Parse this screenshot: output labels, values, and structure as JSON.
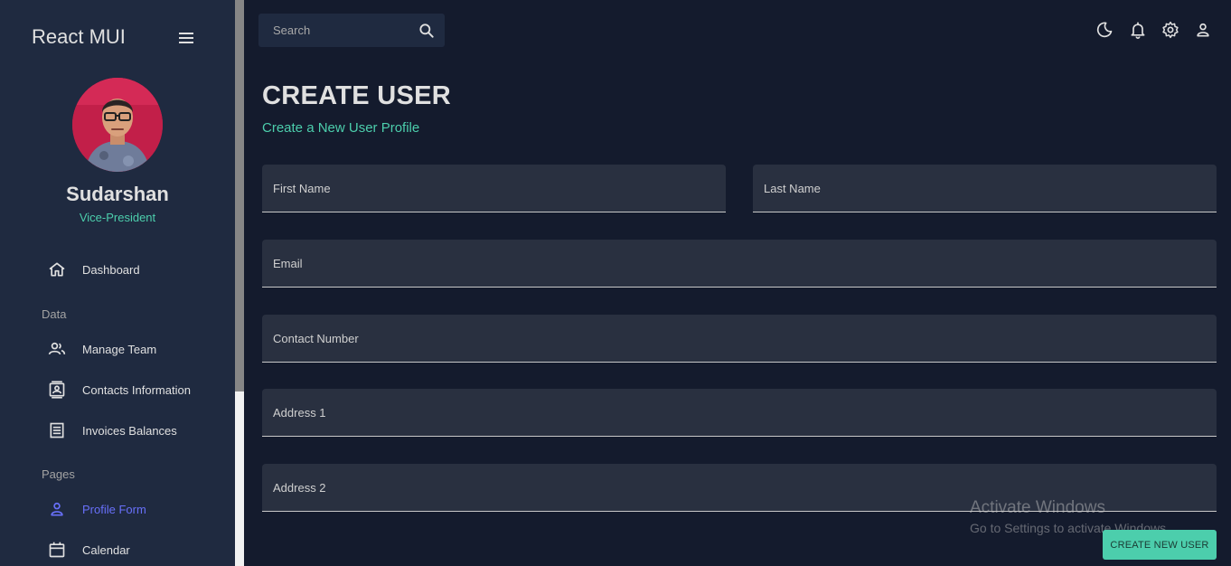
{
  "sidebar": {
    "brand": "React MUI",
    "user": {
      "name": "Sudarshan",
      "role": "Vice-President"
    },
    "sections": {
      "data": "Data",
      "pages": "Pages"
    },
    "items": [
      {
        "label": "Dashboard",
        "icon": "home-icon"
      },
      {
        "label": "Manage Team",
        "icon": "people-icon"
      },
      {
        "label": "Contacts Information",
        "icon": "contacts-icon"
      },
      {
        "label": "Invoices Balances",
        "icon": "receipt-icon"
      },
      {
        "label": "Profile Form",
        "icon": "person-icon",
        "active": true
      },
      {
        "label": "Calendar",
        "icon": "calendar-icon"
      }
    ]
  },
  "topbar": {
    "search_placeholder": "Search",
    "icons": [
      "dark-mode-icon",
      "notifications-icon",
      "settings-icon",
      "person-icon"
    ]
  },
  "main": {
    "title": "CREATE USER",
    "subtitle": "Create a New User Profile",
    "fields": {
      "first_name": "First Name",
      "last_name": "Last Name",
      "email": "Email",
      "contact": "Contact Number",
      "address1": "Address 1",
      "address2": "Address 2"
    },
    "submit_label": "CREATE NEW USER"
  },
  "watermark": {
    "line1": "Activate Windows",
    "line2": "Go to Settings to activate Windows."
  },
  "colors": {
    "background": "#141b2d",
    "sidebar": "#1f2a40",
    "accent_green": "#4cceac",
    "accent_blue": "#6870fa",
    "field": "#293040"
  }
}
